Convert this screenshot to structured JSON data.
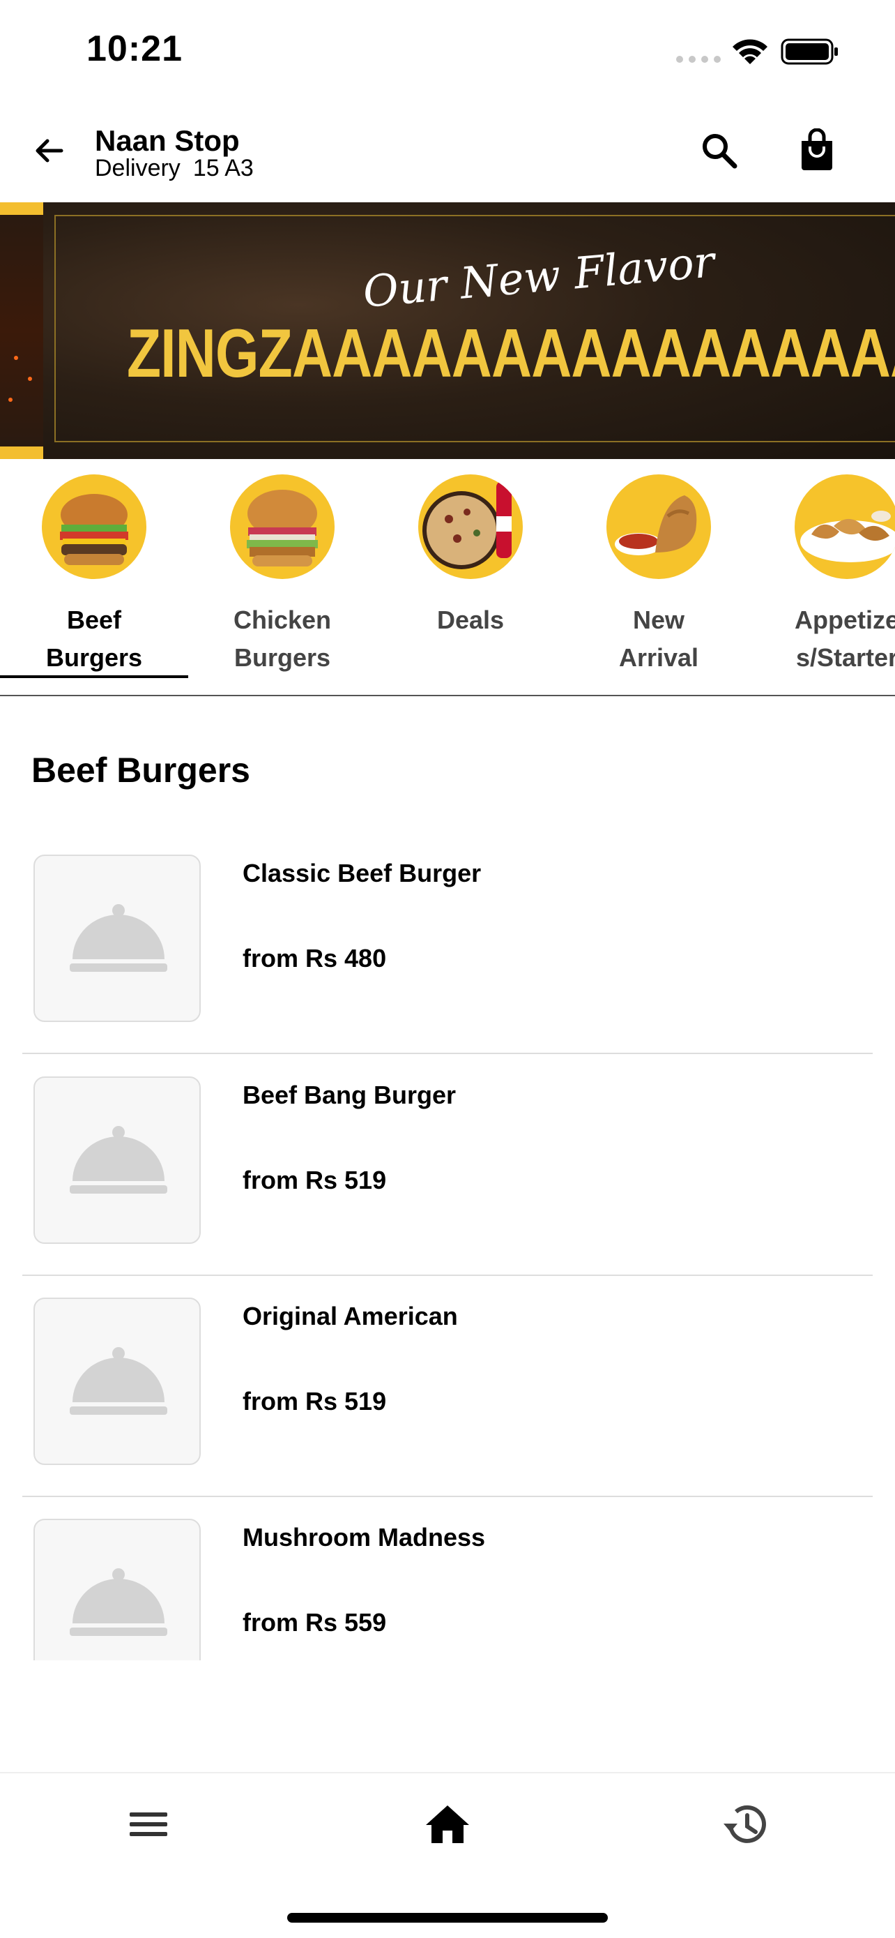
{
  "status_bar": {
    "time": "10:21"
  },
  "header": {
    "store_name": "Naan Stop",
    "delivery_label": "Delivery",
    "delivery_location": "15 A3"
  },
  "banner": {
    "script_text": "Our New Flavor",
    "headline": "ZINGZAAAAAAAAAAAAAAAAAA!",
    "accent_color": "#f1c63f"
  },
  "categories": [
    {
      "label_line1": "Beef",
      "label_line2": "Burgers",
      "active": true,
      "icon": "beef-burger-image"
    },
    {
      "label_line1": "Chicken",
      "label_line2": "Burgers",
      "active": false,
      "icon": "chicken-burger-image"
    },
    {
      "label_line1": "Deals",
      "label_line2": "",
      "active": false,
      "icon": "deals-image"
    },
    {
      "label_line1": "New",
      "label_line2": "Arrival",
      "active": false,
      "icon": "new-arrival-image"
    },
    {
      "label_line1": "Appetize",
      "label_line2": "s/Starter",
      "active": false,
      "icon": "appetizers-image"
    }
  ],
  "section": {
    "title": "Beef Burgers"
  },
  "items": [
    {
      "name": "Classic Beef Burger",
      "price": "from Rs 480"
    },
    {
      "name": "Beef Bang Burger",
      "price": "from Rs 519"
    },
    {
      "name": "Original American",
      "price": "from Rs 519"
    },
    {
      "name": "Mushroom Madness",
      "price": "from Rs 559"
    }
  ],
  "bottom_nav": {
    "icons": [
      "menu-icon",
      "home-icon",
      "history-icon"
    ],
    "active": "home-icon"
  }
}
